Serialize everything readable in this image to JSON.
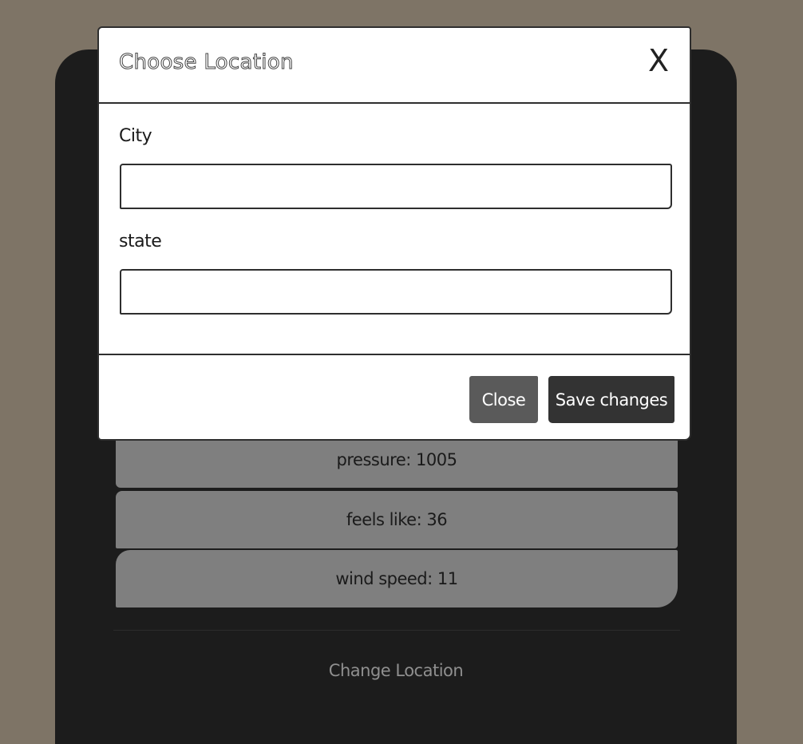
{
  "background": {
    "stats": [
      {
        "text": "pressure: 1005"
      },
      {
        "text": "feels like: 36"
      },
      {
        "text": "wind speed: 11"
      }
    ],
    "change_location_label": "Change Location"
  },
  "modal": {
    "title": "Choose Location",
    "close_icon_glyph": "X",
    "fields": {
      "city": {
        "label": "City",
        "value": "",
        "placeholder": ""
      },
      "state": {
        "label": "state",
        "value": "",
        "placeholder": ""
      }
    },
    "buttons": {
      "close_label": "Close",
      "save_label": "Save changes"
    }
  },
  "colors": {
    "page_background": "#7e7466",
    "card_background": "#1c1c1c",
    "stat_background": "#7f7f7f",
    "close_button": "#5a5a5a",
    "save_button": "#333333"
  }
}
